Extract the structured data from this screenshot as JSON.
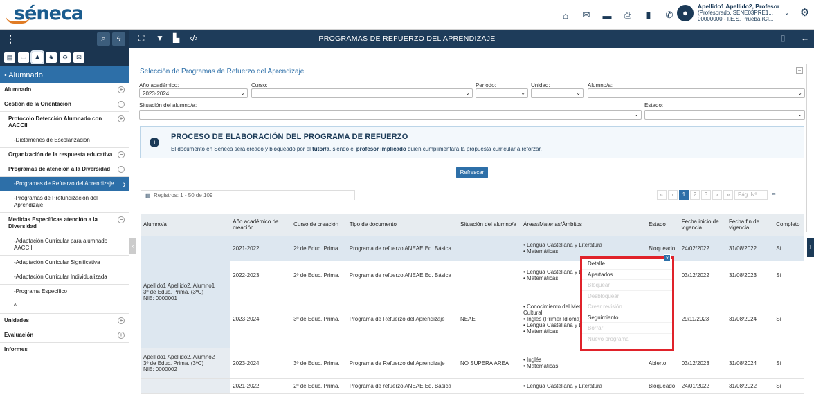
{
  "app": {
    "logo": "séneca"
  },
  "user": {
    "name": "Apellido1 Apellido2, Profesor",
    "role": "(Profesorado, SENE03PRE1...",
    "center": "00000000 - I.E.S. Prueba (Cl..."
  },
  "toolbar": {
    "title": "PROGRAMAS DE REFUERZO DEL APRENDIZAJE"
  },
  "sidebar": {
    "header": "• Alumnado",
    "items": [
      {
        "label": "Alumnado",
        "type": "top",
        "pm": "+"
      },
      {
        "label": "Gestión de la Orientación",
        "type": "top",
        "pm": "−"
      },
      {
        "label": "Protocolo Detección Alumnado con AACCII",
        "type": "sub",
        "pm": "+"
      },
      {
        "label": "-Dictámenes de Escolarización",
        "type": "leaf"
      },
      {
        "label": "Organización de la respuesta educativa",
        "type": "sub",
        "pm": "−"
      },
      {
        "label": "Programas de atención a la Diversidad",
        "type": "sub",
        "pm": "−"
      },
      {
        "label": "-Programas de Refuerzo del Aprendizaje",
        "type": "sel"
      },
      {
        "label": "-Programas de Profundización del Aprendizaje",
        "type": "leaf"
      },
      {
        "label": "Medidas Específicas atención a la Diversidad",
        "type": "sub",
        "pm": "−"
      },
      {
        "label": "-Adaptación Curricular para alumnado AACCII",
        "type": "leaf"
      },
      {
        "label": "-Adaptación Curricular Significativa",
        "type": "leaf"
      },
      {
        "label": "-Adaptación Curricular Individualizada",
        "type": "leaf"
      },
      {
        "label": "-Programa Específico",
        "type": "leaf"
      },
      {
        "label": "^",
        "type": "leaf"
      },
      {
        "label": "Unidades",
        "type": "top",
        "pm": "+"
      },
      {
        "label": "Evaluación",
        "type": "top",
        "pm": "+"
      },
      {
        "label": "Informes",
        "type": "top"
      }
    ]
  },
  "panel": {
    "title": "Selección de Programas de Refuerzo del Aprendizaje",
    "anio_label": "Año académico:",
    "anio_value": "2023-2024",
    "curso_label": "Curso:",
    "periodo_label": "Periodo:",
    "unidad_label": "Unidad:",
    "alumno_label": "Alumno/a:",
    "situacion_label": "Situación del alumno/a:",
    "estado_label": "Estado:",
    "info_title": "PROCESO DE ELABORACIÓN DEL PROGRAMA DE REFUERZO",
    "info_p1": "El documento en Séneca será creado y bloqueado por el ",
    "info_tutor": "tutor/a",
    "info_p2": ", siendo el ",
    "info_prof": "profesor implicado",
    "info_p3": " quien cumplimentará la propuesta curricular a reforzar.",
    "refresh": "Refrescar"
  },
  "list": {
    "registros": "Registros: 1 - 50 de 109",
    "pages": [
      "«",
      "‹",
      "1",
      "2",
      "3",
      "›",
      "»"
    ],
    "pag_placeholder": "Pág. Nº"
  },
  "table": {
    "headers": [
      "Alumno/a",
      "Año académico de creación",
      "Curso de creación",
      "Tipo de documento",
      "Situación del alumno/a",
      "Áreas/Materias/Ámbitos",
      "Estado",
      "Fecha inicio de vigencia",
      "Fecha fin de vigencia",
      "Completo"
    ],
    "student1": {
      "name": "Apellido1 Apellido2, Alumno1",
      "course": "3º de Educ. Prima. (3ºC)",
      "nie": "NIE: 0000001"
    },
    "student2": {
      "name": "Apellido1 Apellido2, Alumno2",
      "course": "3º de Educ. Prima. (3ºC)",
      "nie": "NIE: 0000002"
    },
    "rows": [
      {
        "anio": "2021-2022",
        "curso": "2º de Educ. Prima.",
        "tipo": "Programa de refuerzo ANEAE Ed. Básica",
        "sit": "",
        "areas": [
          "Lengua Castellana y Literatura",
          "Matemáticas"
        ],
        "estado": "Bloqueado",
        "ini": "24/02/2022",
        "fin": "31/08/2022",
        "comp": "Sí"
      },
      {
        "anio": "2022-2023",
        "curso": "2º de Educ. Prima.",
        "tipo": "Programa de refuerzo ANEAE Ed. Básica",
        "sit": "",
        "areas": [
          "Lengua Castellana y Literatura",
          "Matemáticas"
        ],
        "estado": "",
        "ini": "03/12/2022",
        "fin": "31/08/2023",
        "comp": "Sí"
      },
      {
        "anio": "2023-2024",
        "curso": "3º de Educ. Prima.",
        "tipo": "Programa de Refuerzo del Aprendizaje",
        "sit": "NEAE",
        "areas": [
          "Conocimiento del Medio Natural, Social y Cultural",
          "Inglés (Primer Idioma)",
          "Lengua Castellana y Literatura",
          "Matemáticas"
        ],
        "estado": "",
        "ini": "29/11/2023",
        "fin": "31/08/2024",
        "comp": "Sí"
      },
      {
        "anio": "2023-2024",
        "curso": "3º de Educ. Prima.",
        "tipo": "Programa de Refuerzo del Aprendizaje",
        "sit": "NO SUPERA AREA",
        "areas": [
          "Inglés",
          "Matemáticas"
        ],
        "estado": "Abierto",
        "ini": "03/12/2023",
        "fin": "31/08/2024",
        "comp": "Sí"
      },
      {
        "anio": "2021-2022",
        "curso": "2º de Educ. Prima.",
        "tipo": "Programa de refuerzo ANEAE Ed. Básica",
        "sit": "",
        "areas": [
          "Lengua Castellana y Literatura"
        ],
        "estado": "Bloqueado",
        "ini": "24/01/2022",
        "fin": "31/08/2022",
        "comp": "Sí"
      }
    ]
  },
  "context_menu": {
    "items": [
      {
        "label": "Detalle",
        "enabled": true
      },
      {
        "label": "Apartados",
        "enabled": true
      },
      {
        "label": "Bloquear",
        "enabled": false
      },
      {
        "label": "Desbloquear",
        "enabled": false
      },
      {
        "label": "Crear revisión",
        "enabled": false
      },
      {
        "label": "Seguimiento",
        "enabled": true
      },
      {
        "label": "Borrar",
        "enabled": false
      },
      {
        "label": "Nuevo programa",
        "enabled": false
      }
    ]
  },
  "colors": {
    "navy": "#1e3c5a",
    "accent": "#2d6fa8",
    "highlight": "#e0222a"
  }
}
